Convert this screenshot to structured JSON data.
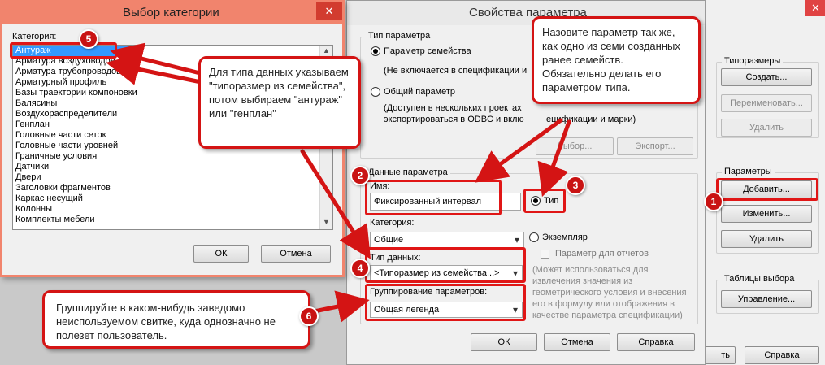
{
  "main_dialog": {
    "title": "Свойства параметра",
    "param_type_group": "Тип параметра",
    "family_param_label": "Параметр семейства",
    "family_param_desc": "(Не включается в спецификации и",
    "shared_param_label": "Общий параметр",
    "shared_param_desc_1": "(Доступен в нескольких проектах",
    "shared_param_desc_2": "экспортироваться в ODBC и вклю",
    "shared_param_desc_3": "ецификации и марки)",
    "select_button": "Выбор...",
    "export_button": "Экспорт...",
    "data_group": "Данные параметра",
    "name_label": "Имя:",
    "name_value": "Фиксированный интервал",
    "type_radio_label": "Тип",
    "instance_radio_label": "Экземпляр",
    "category_label": "Категория:",
    "category_value": "Общие",
    "report_param_label": "Параметр для отчетов",
    "report_desc": [
      "(Может использоваться для",
      "извлечения значения из",
      "геометрического условия и внесения",
      "его в формулу или отображения в",
      "качестве параметра спецификации)"
    ],
    "datatype_label": "Тип данных:",
    "datatype_value": "<Типоразмер из семейства...>",
    "grouping_label": "Группирование параметров:",
    "grouping_value": "Общая легенда",
    "ok_button": "ОК",
    "cancel_button": "Отмена",
    "help_button": "Справка"
  },
  "right_panel": {
    "typesizes_group": "Типоразмеры",
    "create_button": "Создать...",
    "rename_button": "Переименовать...",
    "delete_type_button": "Удалить",
    "params_group": "Параметры",
    "add_button": "Добавить...",
    "modify_button": "Изменить...",
    "delete_param_button": "Удалить",
    "lookup_group": "Таблицы выбора",
    "manage_button": "Управление...",
    "help_button": "Справка",
    "cut_ok_label": "ть"
  },
  "category_dialog": {
    "title": "Выбор категории",
    "list_label": "Категория:",
    "items": [
      "Антураж",
      "Арматура воздуховодов",
      "Арматура трубопроводов",
      "Арматурный профиль",
      "Базы траектории компоновки",
      "Балясины",
      "Воздухораспределители",
      "Генплан",
      "Головные части сеток",
      "Головные части уровней",
      "Граничные условия",
      "Датчики",
      "Двери",
      "Заголовки фрагментов",
      "Каркас несущий",
      "Колонны",
      "Комплекты мебели"
    ],
    "ok_button": "ОК",
    "cancel_button": "Отмена"
  },
  "callouts": {
    "c1": "Для типа данных указываем \"типоразмер из семейства\", потом выбираем \"антураж\" или \"генплан\"",
    "c2": "Назовите параметр так же, как одно из семи созданных ранее семейств. Обязательно делать его параметром типа.",
    "c3": "Группируйте в каком-нибудь заведомо неиспользуемом свитке, куда однозначно не полезет пользователь."
  },
  "markers": [
    "1",
    "2",
    "3",
    "4",
    "5",
    "6"
  ],
  "colors": {
    "accent_red": "#d41414",
    "close_red": "#e04343",
    "selection_blue": "#3399ff"
  }
}
